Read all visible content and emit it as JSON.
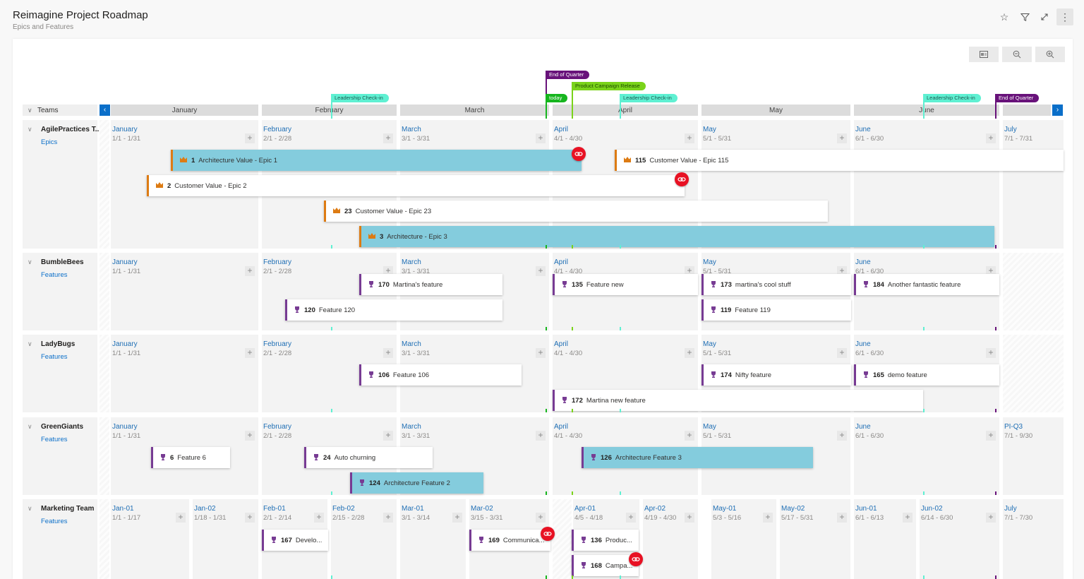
{
  "header": {
    "title": "Reimagine Project Roadmap",
    "subtitle": "Epics and Features",
    "icons": [
      "star-icon",
      "filter-icon",
      "expand-icon",
      "more-icon"
    ]
  },
  "toolbar": {
    "buttons": [
      "backlog-icon",
      "zoom-out-icon",
      "zoom-in-icon"
    ]
  },
  "timeline": {
    "teams_label": "Teams",
    "months": [
      "January",
      "February",
      "March",
      "April",
      "May",
      "June",
      ""
    ],
    "markers": [
      {
        "label": "Leadership Check-in",
        "color": "#5ff0d2",
        "text_color": "#1e5a52"
      },
      {
        "label": "End of Quarter",
        "color": "#68127a",
        "text_color": "#ffffff"
      },
      {
        "label": "today",
        "color": "#16b51e",
        "text_color": "#ffffff"
      },
      {
        "label": "Product Campaign Release",
        "color": "#7ad31a",
        "text_color": "#1f4d00"
      },
      {
        "label": "Leadership Check-in",
        "color": "#5ff0d2",
        "text_color": "#1e5a52"
      },
      {
        "label": "Leadership Check-in",
        "color": "#5ff0d2",
        "text_color": "#1e5a52"
      },
      {
        "label": "End of Quarter",
        "color": "#68127a",
        "text_color": "#ffffff"
      }
    ]
  },
  "teams": [
    {
      "name": "AgilePractices T...",
      "level": "Epics",
      "columns": [
        {
          "label": "January",
          "dates": "1/1 - 1/31"
        },
        {
          "label": "February",
          "dates": "2/1 - 2/28"
        },
        {
          "label": "March",
          "dates": "3/1 - 3/31"
        },
        {
          "label": "April",
          "dates": "4/1 - 4/30"
        },
        {
          "label": "May",
          "dates": "5/1 - 5/31"
        },
        {
          "label": "June",
          "dates": "6/1 - 6/30"
        },
        {
          "label": "July",
          "dates": "7/1 - 7/31"
        }
      ],
      "items": [
        {
          "id": "1",
          "title": "Architecture Value - Epic 1",
          "highlight": true,
          "dependency": true
        },
        {
          "id": "115",
          "title": "Customer Value - Epic 115",
          "highlight": false,
          "dependency": false
        },
        {
          "id": "2",
          "title": "Customer Value - Epic 2",
          "highlight": false,
          "dependency": true
        },
        {
          "id": "23",
          "title": "Customer Value - Epic 23",
          "highlight": false,
          "dependency": false
        },
        {
          "id": "3",
          "title": "Architecture - Epic 3",
          "highlight": true,
          "dependency": false
        }
      ]
    },
    {
      "name": "BumbleBees",
      "level": "Features",
      "columns": [
        {
          "label": "January",
          "dates": "1/1 - 1/31"
        },
        {
          "label": "February",
          "dates": "2/1 - 2/28"
        },
        {
          "label": "March",
          "dates": "3/1 - 3/31"
        },
        {
          "label": "April",
          "dates": "4/1 - 4/30"
        },
        {
          "label": "May",
          "dates": "5/1 - 5/31"
        },
        {
          "label": "June",
          "dates": "6/1 - 6/30"
        }
      ],
      "items": [
        {
          "id": "170",
          "title": "Martina's feature"
        },
        {
          "id": "135",
          "title": "Feature new"
        },
        {
          "id": "173",
          "title": "martina's cool stuff"
        },
        {
          "id": "184",
          "title": "Another fantastic feature"
        },
        {
          "id": "120",
          "title": "Feature 120"
        },
        {
          "id": "119",
          "title": "Feature 119"
        }
      ]
    },
    {
      "name": "LadyBugs",
      "level": "Features",
      "columns": [
        {
          "label": "January",
          "dates": "1/1 - 1/31"
        },
        {
          "label": "February",
          "dates": "2/1 - 2/28"
        },
        {
          "label": "March",
          "dates": "3/1 - 3/31"
        },
        {
          "label": "April",
          "dates": "4/1 - 4/30"
        },
        {
          "label": "May",
          "dates": "5/1 - 5/31"
        },
        {
          "label": "June",
          "dates": "6/1 - 6/30"
        }
      ],
      "items": [
        {
          "id": "106",
          "title": "Feature 106"
        },
        {
          "id": "174",
          "title": "Nifty feature"
        },
        {
          "id": "165",
          "title": "demo feature"
        },
        {
          "id": "172",
          "title": "Martina new feature"
        }
      ]
    },
    {
      "name": "GreenGiants",
      "level": "Features",
      "columns": [
        {
          "label": "January",
          "dates": "1/1 - 1/31"
        },
        {
          "label": "February",
          "dates": "2/1 - 2/28"
        },
        {
          "label": "March",
          "dates": "3/1 - 3/31"
        },
        {
          "label": "April",
          "dates": "4/1 - 4/30"
        },
        {
          "label": "May",
          "dates": "5/1 - 5/31"
        },
        {
          "label": "June",
          "dates": "6/1 - 6/30"
        },
        {
          "label": "PI-Q3",
          "dates": "7/1 - 9/30"
        }
      ],
      "items": [
        {
          "id": "6",
          "title": "Feature 6",
          "highlight": false
        },
        {
          "id": "24",
          "title": "Auto churning",
          "highlight": false
        },
        {
          "id": "126",
          "title": "Architecture Feature 3",
          "highlight": true
        },
        {
          "id": "124",
          "title": "Architecture Feature 2",
          "highlight": true
        }
      ]
    },
    {
      "name": "Marketing Team",
      "level": "Features",
      "columns": [
        {
          "label": "Jan-01",
          "dates": "1/1 - 1/17"
        },
        {
          "label": "Jan-02",
          "dates": "1/18 - 1/31"
        },
        {
          "label": "Feb-01",
          "dates": "2/1 - 2/14"
        },
        {
          "label": "Feb-02",
          "dates": "2/15 - 2/28"
        },
        {
          "label": "Mar-01",
          "dates": "3/1 - 3/14"
        },
        {
          "label": "Mar-02",
          "dates": "3/15 - 3/31"
        },
        {
          "label": "Apr-01",
          "dates": "4/5 - 4/18"
        },
        {
          "label": "Apr-02",
          "dates": "4/19 - 4/30"
        },
        {
          "label": "May-01",
          "dates": "5/3 - 5/16"
        },
        {
          "label": "May-02",
          "dates": "5/17 - 5/31"
        },
        {
          "label": "Jun-01",
          "dates": "6/1 - 6/13"
        },
        {
          "label": "Jun-02",
          "dates": "6/14 - 6/30"
        },
        {
          "label": "July",
          "dates": "7/1 - 7/30"
        }
      ],
      "items": [
        {
          "id": "167",
          "title": "Develo...",
          "dependency": false
        },
        {
          "id": "169",
          "title": "Communica...",
          "dependency": true
        },
        {
          "id": "136",
          "title": "Produc...",
          "dependency": false
        },
        {
          "id": "168",
          "title": "Campa...",
          "dependency": true
        }
      ]
    }
  ]
}
